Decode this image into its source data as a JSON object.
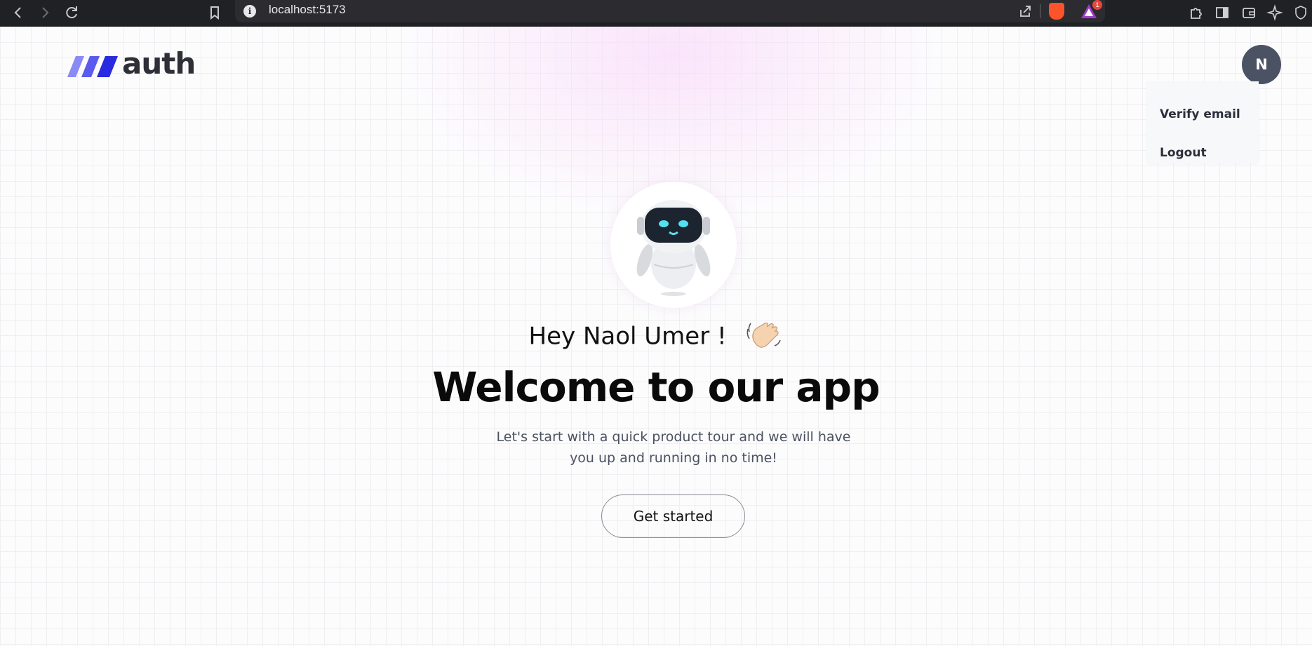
{
  "browser": {
    "url": "localhost:5173",
    "rewards_badge": "1"
  },
  "brand": {
    "logo_text": "auth",
    "logo_colors": [
      "#8a8af5",
      "#5a5aee",
      "#2a2ae0"
    ]
  },
  "user_menu": {
    "avatar_initial": "N",
    "items": [
      {
        "label": "Verify email"
      },
      {
        "label": "Logout"
      }
    ]
  },
  "hero": {
    "greeting": "Hey Naol Umer !",
    "wave_icon": "waving-hand-icon",
    "robot_icon": "robot-icon",
    "title": "Welcome to our app",
    "description": "Let's start with a quick product tour and we will have you up and running in no time!",
    "cta_label": "Get started"
  }
}
